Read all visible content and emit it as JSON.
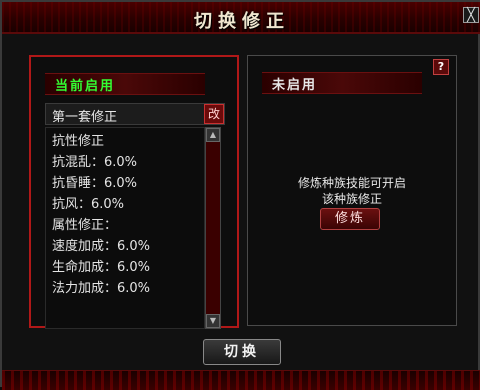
{
  "window": {
    "title": "切换修正",
    "close_label": "╳"
  },
  "left_panel": {
    "header": "当前启用",
    "set_name": "第一套修正",
    "edit_label": "改",
    "stats": [
      "抗性修正",
      "抗混乱：6.0%",
      "抗昏睡：6.0%",
      "抗风：6.0%",
      "属性修正：",
      "速度加成：6.0%",
      "生命加成：6.0%",
      "法力加成：6.0%"
    ],
    "scroll_up": "▲",
    "scroll_down": "▼"
  },
  "right_panel": {
    "header": "未启用",
    "help_label": "?",
    "info_line1": "修炼种族技能可开启",
    "info_line2": "该种族修正",
    "cultivate_label": "修炼"
  },
  "footer": {
    "switch_label": "切换"
  },
  "colors": {
    "accent_red": "#b01818",
    "active_green": "#33ff33"
  }
}
